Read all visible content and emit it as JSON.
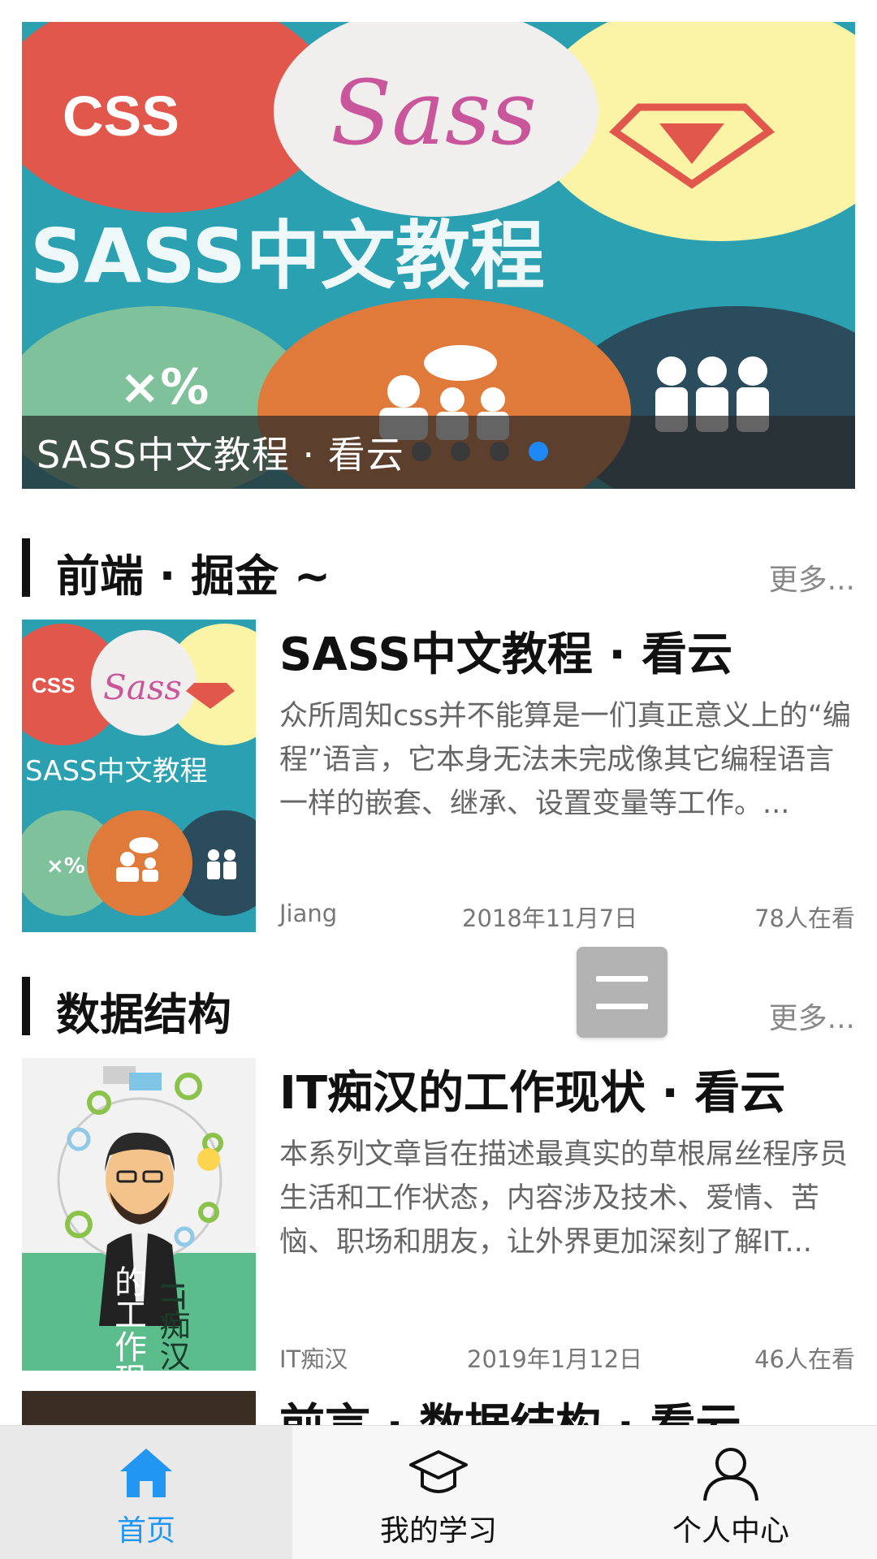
{
  "banner": {
    "caption": "SASS中文教程 · 看云",
    "image_text_top": "CSS",
    "image_logo": "Sass",
    "image_headline": "SASS中文教程",
    "dots_count": 4,
    "active_dot": 4
  },
  "sections": [
    {
      "title": "前端 · 掘金 ~",
      "more": "更多...",
      "card": {
        "title": "SASS中文教程 · 看云",
        "description": "众所周知css并不能算是一们真正意义上的“编程”语言，它本身无法未完成像其它编程语言一样的嵌套、继承、设置变量等工作。...",
        "author": "Jiang",
        "date": "2018年11月7日",
        "views": "78人在看",
        "thumb_text_top": "CSS",
        "thumb_logo": "Sass",
        "thumb_headline": "SASS中文教程"
      }
    },
    {
      "title": "数据结构",
      "more": "更多...",
      "card": {
        "title": "IT痴汉的工作现状 · 看云",
        "description": "本系列文章旨在描述最真实的草根屌丝程序员生活和工作状态，内容涉及技术、爱情、苦恼、职场和朋友，让外界更加深刻了解IT...",
        "author": "IT痴汉",
        "date": "2019年1月12日",
        "views": "46人在看",
        "thumb_text_right": "IT痴汉",
        "thumb_text_left": "的工作现状"
      }
    },
    {
      "card": {
        "title": "前言 · 数据结构 · 看云"
      }
    }
  ],
  "bottom_nav": {
    "items": [
      {
        "label": "首页",
        "icon": "home-icon",
        "active": true
      },
      {
        "label": "我的学习",
        "icon": "graduation-cap-icon",
        "active": false
      },
      {
        "label": "个人中心",
        "icon": "user-icon",
        "active": false
      }
    ]
  },
  "colors": {
    "accent": "#2196f3",
    "banner_bg": "#2aa0b0",
    "text_primary": "#111111",
    "text_secondary": "#666666",
    "text_muted": "#888888"
  }
}
